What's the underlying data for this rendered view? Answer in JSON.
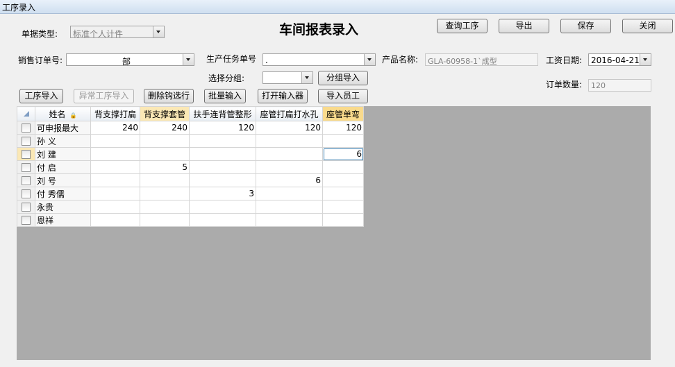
{
  "window": {
    "title": "工序录入"
  },
  "heading": "车间报表录入",
  "toolbar": {
    "query": "查询工序",
    "export": "导出",
    "save": "保存",
    "close": "关闭"
  },
  "form": {
    "doc_type_label": "单据类型:",
    "doc_type_value": "标准个人计件",
    "sales_order_label": "销售订单号:",
    "sales_order_value": "部",
    "task_label": "生产任务单号",
    "task_value": ".",
    "product_label": "产品名称:",
    "product_value": "GLA-60958-1`成型",
    "wage_date_label": "工资日期:",
    "wage_date_value": "2016-04-21",
    "group_label": "选择分组:",
    "group_value": "",
    "order_qty_label": "订单数量:",
    "order_qty_value": "120"
  },
  "buttons": {
    "group_import": "分组导入",
    "process_import": "工序导入",
    "abnormal_import": "异常工序导入",
    "delete_checked": "删除钩选行",
    "batch_input": "批量输入",
    "open_input": "打开输入器",
    "import_staff": "导入员工"
  },
  "grid": {
    "columns": [
      "姓名",
      "背支撑打扁",
      "背支撑套管",
      "扶手连背管整形",
      "座管打扁打水孔",
      "座管单弯"
    ],
    "rows": [
      {
        "name": "可申报最大",
        "values": [
          "240",
          "240",
          "120",
          "120",
          "120"
        ]
      },
      {
        "name": "孙  义",
        "values": [
          "",
          "",
          "",
          "",
          ""
        ]
      },
      {
        "name": "刘  建",
        "values": [
          "",
          "",
          "",
          "",
          "6"
        ]
      },
      {
        "name": "付  启",
        "values": [
          "",
          "5",
          "",
          "",
          ""
        ]
      },
      {
        "name": "刘  号",
        "values": [
          "",
          "",
          "",
          "6",
          ""
        ]
      },
      {
        "name": "付  秀儒",
        "values": [
          "",
          "",
          "3",
          "",
          ""
        ]
      },
      {
        "name": "  永贵",
        "values": [
          "",
          "",
          "",
          "",
          ""
        ]
      },
      {
        "name": "  恩祥",
        "values": [
          "",
          "",
          "",
          "",
          ""
        ]
      }
    ]
  }
}
